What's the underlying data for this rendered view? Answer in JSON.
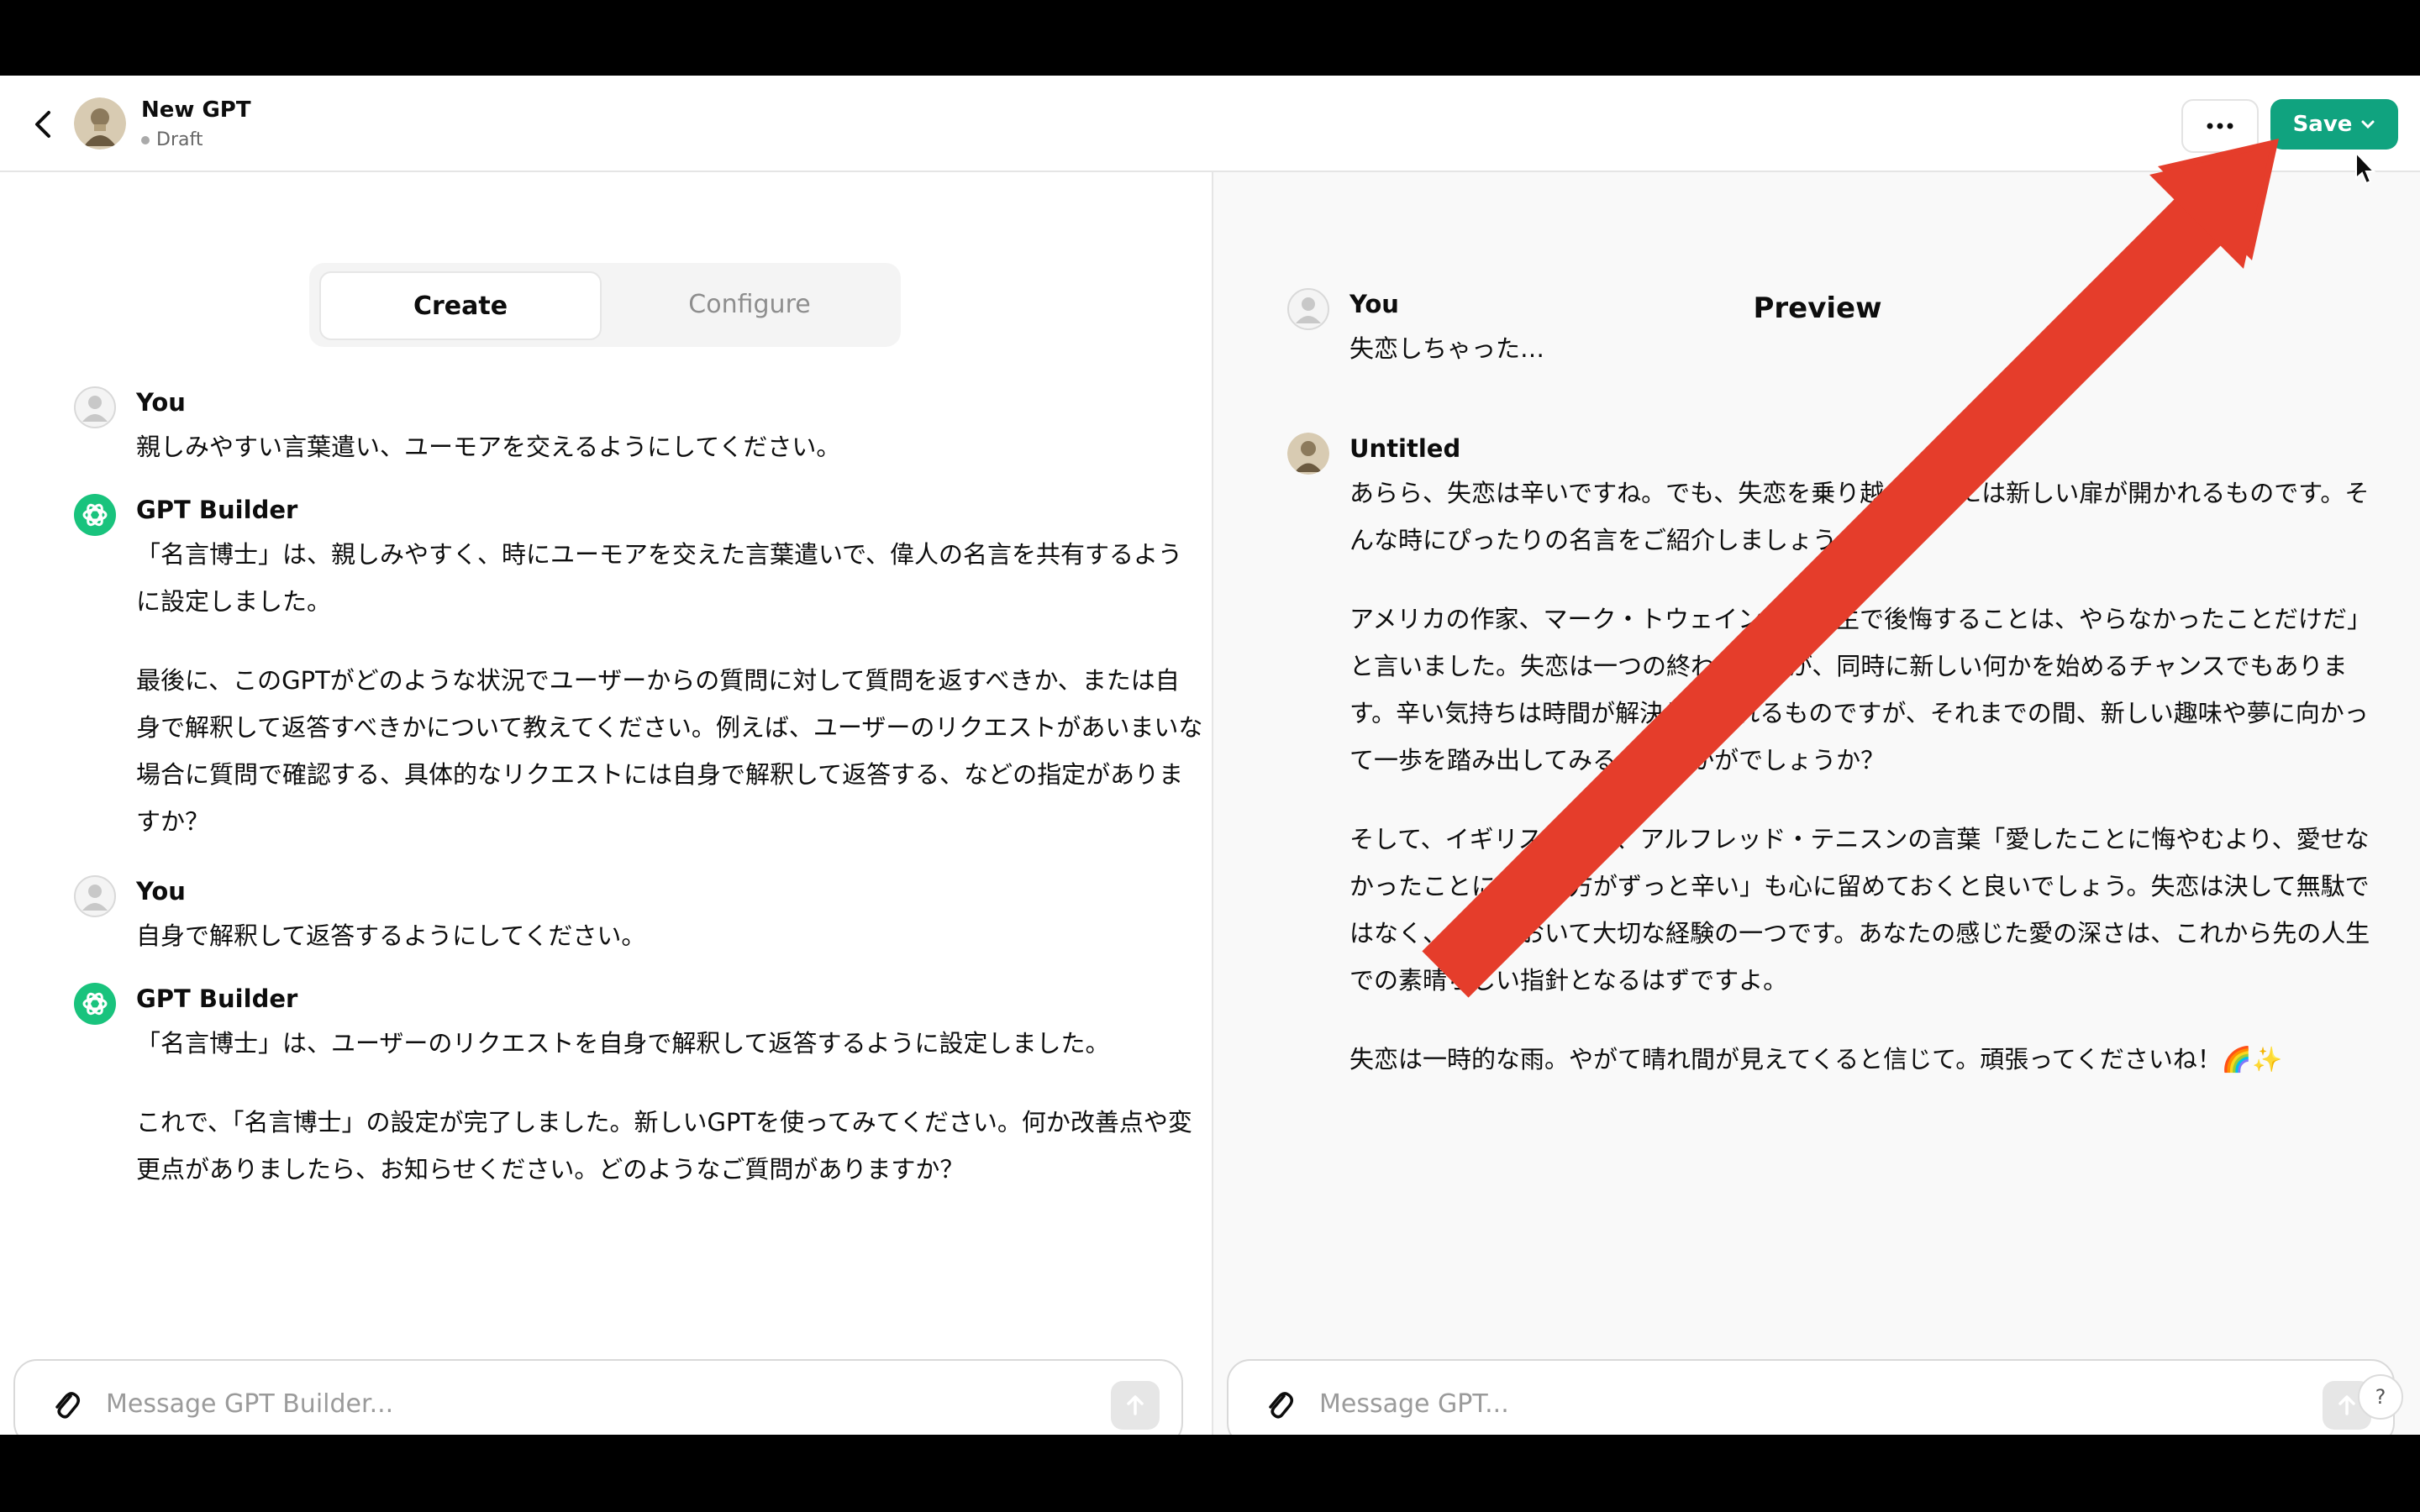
{
  "header": {
    "title": "New GPT",
    "status": "Draft",
    "save_label": "Save"
  },
  "tabs": {
    "create": "Create",
    "configure": "Configure"
  },
  "builder_chat": [
    {
      "sender": "You",
      "paragraphs": [
        "親しみやすい言葉遣い、ユーモアを交えるようにしてください。"
      ]
    },
    {
      "sender": "GPT Builder",
      "paragraphs": [
        "「名言博士」は、親しみやすく、時にユーモアを交えた言葉遣いで、偉人の名言を共有するように設定しました。",
        "最後に、このGPTがどのような状況でユーザーからの質問に対して質問を返すべきか、または自身で解釈して返答すべきかについて教えてください。例えば、ユーザーのリクエストがあいまいな場合に質問で確認する、具体的なリクエストには自身で解釈して返答する、などの指定がありますか？"
      ]
    },
    {
      "sender": "You",
      "paragraphs": [
        "自身で解釈して返答するようにしてください。"
      ]
    },
    {
      "sender": "GPT Builder",
      "paragraphs": [
        "「名言博士」は、ユーザーのリクエストを自身で解釈して返答するように設定しました。",
        "これで、「名言博士」の設定が完了しました。新しいGPTを使ってみてください。何か改善点や変更点がありましたら、お知らせください。どのようなご質問がありますか？"
      ]
    }
  ],
  "preview": {
    "title": "Preview",
    "chat": [
      {
        "sender": "You",
        "paragraphs": [
          "失恋しちゃった…"
        ]
      },
      {
        "sender": "Untitled",
        "paragraphs": [
          "あらら、失恋は辛いですね。でも、失恋を乗り越えた後には新しい扉が開かれるものです。そんな時にぴったりの名言をご紹介しましょう。",
          "アメリカの作家、マーク・トウェインは「人生で後悔することは、やらなかったことだけだ」と言いました。失恋は一つの終わりですが、同時に新しい何かを始めるチャンスでもあります。辛い気持ちは時間が解決してくれるものですが、それまでの間、新しい趣味や夢に向かって一歩を踏み出してみるのはいかがでしょうか？",
          "そして、イギリスの詩人、アルフレッド・テニスンの言葉「愛したことに悔やむより、愛せなかったことに悔やむ方がずっと辛い」も心に留めておくと良いでしょう。失恋は決して無駄ではなく、人生において大切な経験の一つです。あなたの感じた愛の深さは、これから先の人生での素晴らしい指針となるはずですよ。",
          "失恋は一時的な雨。やがて晴れ間が見えてくると信じて。頑張ってくださいね！🌈✨"
        ]
      }
    ]
  },
  "composer": {
    "builder_placeholder": "Message GPT Builder...",
    "preview_placeholder": "Message GPT..."
  },
  "help_label": "?",
  "colors": {
    "save_green": "#10a37f",
    "annotation_arrow": "#e53d2b",
    "builder_icon": "#19c37d"
  },
  "icons": [
    "back-arrow-icon",
    "more-icon",
    "chevron-down-icon",
    "paperclip-icon",
    "send-arrow-icon",
    "openai-logo-icon",
    "user-placeholder-icon",
    "mouse-cursor-icon"
  ]
}
